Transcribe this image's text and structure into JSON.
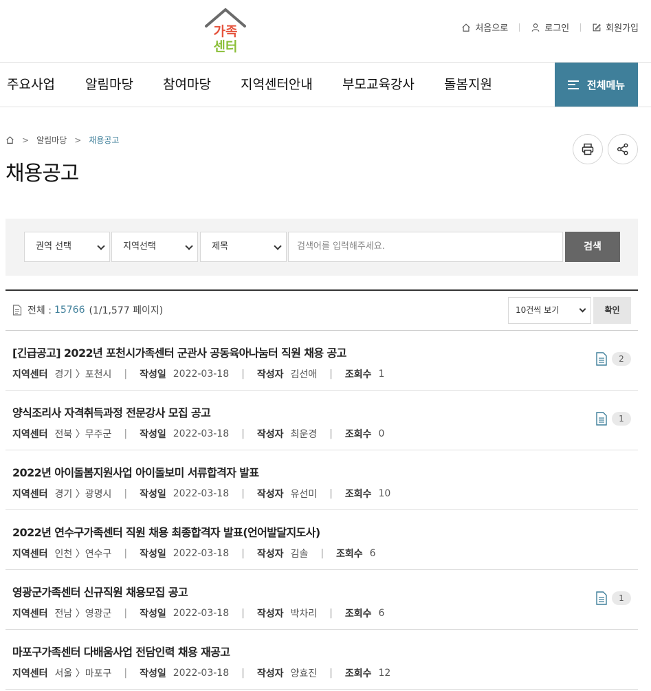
{
  "header": {
    "logo_line1": "가족",
    "logo_line2": "센터",
    "util": {
      "home": "처음으로",
      "login": "로그인",
      "join": "회원가입"
    }
  },
  "gnb": {
    "items": [
      "주요사업",
      "알림마당",
      "참여마당",
      "지역센터안내",
      "부모교육강사",
      "돌봄지원"
    ],
    "all_menu": "전체메뉴"
  },
  "breadcrumb": {
    "level1": "알림마당",
    "level2": "채용공고"
  },
  "page_title": "채용공고",
  "search": {
    "region": "권역 선택",
    "area": "지역선택",
    "field": "제목",
    "placeholder": "검색어를 입력해주세요.",
    "button": "검색"
  },
  "list": {
    "total_label": "전체 :",
    "total_count": "15766",
    "page_info": "(1/1,577 페이지)",
    "per_page": "10건씩 보기",
    "confirm": "확인"
  },
  "meta_labels": {
    "center": "지역센터",
    "date": "작성일",
    "author": "작성자",
    "views": "조회수"
  },
  "rows": [
    {
      "title": "[긴급공고] 2022년 포천시가족센터 군관사 공동육아나눔터 직원 채용 공고",
      "center": "경기 〉포천시",
      "date": "2022-03-18",
      "author": "김선애",
      "views": "1",
      "attach": "2"
    },
    {
      "title": "양식조리사 자격취득과정 전문강사 모집 공고",
      "center": "전북 〉무주군",
      "date": "2022-03-18",
      "author": "최운경",
      "views": "0",
      "attach": "1"
    },
    {
      "title": "2022년 아이돌봄지원사업 아이돌보미 서류합격자 발표",
      "center": "경기 〉광명시",
      "date": "2022-03-18",
      "author": "유선미",
      "views": "10",
      "attach": ""
    },
    {
      "title": "2022년 연수구가족센터 직원 채용 최종합격자 발표(언어발달지도사)",
      "center": "인천 〉연수구",
      "date": "2022-03-18",
      "author": "김솔",
      "views": "6",
      "attach": ""
    },
    {
      "title": "영광군가족센터 신규직원 채용모집 공고",
      "center": "전남 〉영광군",
      "date": "2022-03-18",
      "author": "박차리",
      "views": "6",
      "attach": "1"
    },
    {
      "title": "마포구가족센터 다배움사업 전담인력 채용 재공고",
      "center": "서울 〉마포구",
      "date": "2022-03-18",
      "author": "양효진",
      "views": "12",
      "attach": ""
    }
  ],
  "colors": {
    "accent": "#3f7f9a",
    "search_button": "#666666"
  }
}
